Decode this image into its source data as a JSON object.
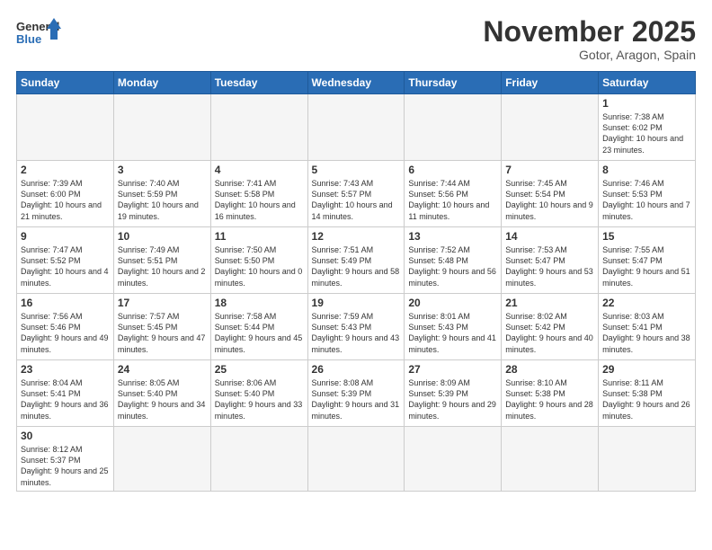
{
  "logo": {
    "text_general": "General",
    "text_blue": "Blue"
  },
  "title": "November 2025",
  "subtitle": "Gotor, Aragon, Spain",
  "days_of_week": [
    "Sunday",
    "Monday",
    "Tuesday",
    "Wednesday",
    "Thursday",
    "Friday",
    "Saturday"
  ],
  "weeks": [
    [
      {
        "day": "",
        "info": ""
      },
      {
        "day": "",
        "info": ""
      },
      {
        "day": "",
        "info": ""
      },
      {
        "day": "",
        "info": ""
      },
      {
        "day": "",
        "info": ""
      },
      {
        "day": "",
        "info": ""
      },
      {
        "day": "1",
        "info": "Sunrise: 7:38 AM\nSunset: 6:02 PM\nDaylight: 10 hours and 23 minutes."
      }
    ],
    [
      {
        "day": "2",
        "info": "Sunrise: 7:39 AM\nSunset: 6:00 PM\nDaylight: 10 hours and 21 minutes."
      },
      {
        "day": "3",
        "info": "Sunrise: 7:40 AM\nSunset: 5:59 PM\nDaylight: 10 hours and 19 minutes."
      },
      {
        "day": "4",
        "info": "Sunrise: 7:41 AM\nSunset: 5:58 PM\nDaylight: 10 hours and 16 minutes."
      },
      {
        "day": "5",
        "info": "Sunrise: 7:43 AM\nSunset: 5:57 PM\nDaylight: 10 hours and 14 minutes."
      },
      {
        "day": "6",
        "info": "Sunrise: 7:44 AM\nSunset: 5:56 PM\nDaylight: 10 hours and 11 minutes."
      },
      {
        "day": "7",
        "info": "Sunrise: 7:45 AM\nSunset: 5:54 PM\nDaylight: 10 hours and 9 minutes."
      },
      {
        "day": "8",
        "info": "Sunrise: 7:46 AM\nSunset: 5:53 PM\nDaylight: 10 hours and 7 minutes."
      }
    ],
    [
      {
        "day": "9",
        "info": "Sunrise: 7:47 AM\nSunset: 5:52 PM\nDaylight: 10 hours and 4 minutes."
      },
      {
        "day": "10",
        "info": "Sunrise: 7:49 AM\nSunset: 5:51 PM\nDaylight: 10 hours and 2 minutes."
      },
      {
        "day": "11",
        "info": "Sunrise: 7:50 AM\nSunset: 5:50 PM\nDaylight: 10 hours and 0 minutes."
      },
      {
        "day": "12",
        "info": "Sunrise: 7:51 AM\nSunset: 5:49 PM\nDaylight: 9 hours and 58 minutes."
      },
      {
        "day": "13",
        "info": "Sunrise: 7:52 AM\nSunset: 5:48 PM\nDaylight: 9 hours and 56 minutes."
      },
      {
        "day": "14",
        "info": "Sunrise: 7:53 AM\nSunset: 5:47 PM\nDaylight: 9 hours and 53 minutes."
      },
      {
        "day": "15",
        "info": "Sunrise: 7:55 AM\nSunset: 5:47 PM\nDaylight: 9 hours and 51 minutes."
      }
    ],
    [
      {
        "day": "16",
        "info": "Sunrise: 7:56 AM\nSunset: 5:46 PM\nDaylight: 9 hours and 49 minutes."
      },
      {
        "day": "17",
        "info": "Sunrise: 7:57 AM\nSunset: 5:45 PM\nDaylight: 9 hours and 47 minutes."
      },
      {
        "day": "18",
        "info": "Sunrise: 7:58 AM\nSunset: 5:44 PM\nDaylight: 9 hours and 45 minutes."
      },
      {
        "day": "19",
        "info": "Sunrise: 7:59 AM\nSunset: 5:43 PM\nDaylight: 9 hours and 43 minutes."
      },
      {
        "day": "20",
        "info": "Sunrise: 8:01 AM\nSunset: 5:43 PM\nDaylight: 9 hours and 41 minutes."
      },
      {
        "day": "21",
        "info": "Sunrise: 8:02 AM\nSunset: 5:42 PM\nDaylight: 9 hours and 40 minutes."
      },
      {
        "day": "22",
        "info": "Sunrise: 8:03 AM\nSunset: 5:41 PM\nDaylight: 9 hours and 38 minutes."
      }
    ],
    [
      {
        "day": "23",
        "info": "Sunrise: 8:04 AM\nSunset: 5:41 PM\nDaylight: 9 hours and 36 minutes."
      },
      {
        "day": "24",
        "info": "Sunrise: 8:05 AM\nSunset: 5:40 PM\nDaylight: 9 hours and 34 minutes."
      },
      {
        "day": "25",
        "info": "Sunrise: 8:06 AM\nSunset: 5:40 PM\nDaylight: 9 hours and 33 minutes."
      },
      {
        "day": "26",
        "info": "Sunrise: 8:08 AM\nSunset: 5:39 PM\nDaylight: 9 hours and 31 minutes."
      },
      {
        "day": "27",
        "info": "Sunrise: 8:09 AM\nSunset: 5:39 PM\nDaylight: 9 hours and 29 minutes."
      },
      {
        "day": "28",
        "info": "Sunrise: 8:10 AM\nSunset: 5:38 PM\nDaylight: 9 hours and 28 minutes."
      },
      {
        "day": "29",
        "info": "Sunrise: 8:11 AM\nSunset: 5:38 PM\nDaylight: 9 hours and 26 minutes."
      }
    ],
    [
      {
        "day": "30",
        "info": "Sunrise: 8:12 AM\nSunset: 5:37 PM\nDaylight: 9 hours and 25 minutes."
      },
      {
        "day": "",
        "info": ""
      },
      {
        "day": "",
        "info": ""
      },
      {
        "day": "",
        "info": ""
      },
      {
        "day": "",
        "info": ""
      },
      {
        "day": "",
        "info": ""
      },
      {
        "day": "",
        "info": ""
      }
    ]
  ]
}
